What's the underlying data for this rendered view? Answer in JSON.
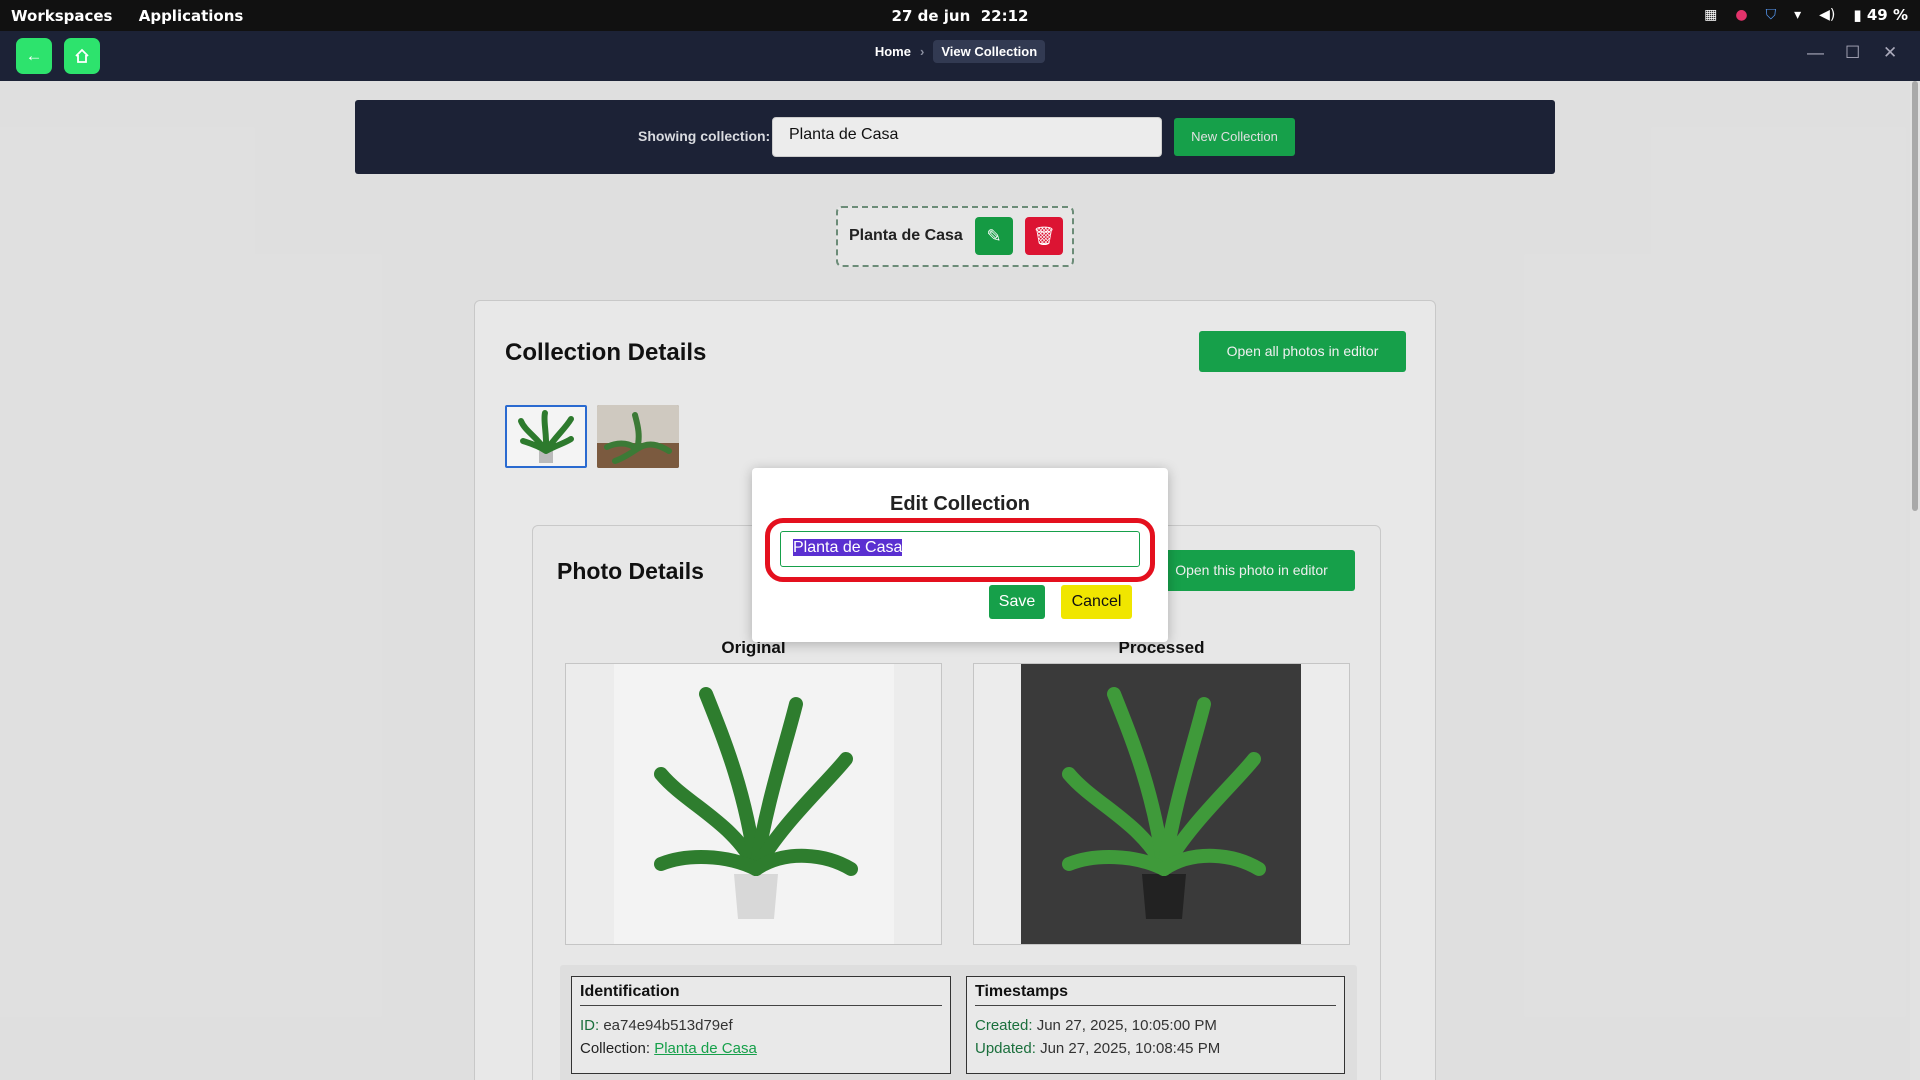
{
  "system_bar": {
    "workspaces": "Workspaces",
    "applications": "Applications",
    "date": "27 de jun",
    "time": "22:12",
    "battery": "49 %"
  },
  "header": {
    "breadcrumb_home": "Home",
    "breadcrumb_separator": "›",
    "breadcrumb_current": "View Collection"
  },
  "collection_bar": {
    "label": "Showing collection:",
    "selected": "Planta de Casa",
    "new_button": "New Collection"
  },
  "chip": {
    "name": "Planta de Casa"
  },
  "collection_details": {
    "title": "Collection Details",
    "open_all_button": "Open all photos in editor"
  },
  "photo_details": {
    "title": "Photo Details",
    "open_this_button": "Open this photo in editor",
    "original_label": "Original",
    "processed_label": "Processed",
    "identification": {
      "title": "Identification",
      "id_key": "ID:",
      "id_value": "ea74e94b513d79ef",
      "collection_key": "Collection:",
      "collection_value": "Planta de Casa"
    },
    "timestamps": {
      "title": "Timestamps",
      "created_key": "Created:",
      "created_value": "Jun 27, 2025, 10:05:00 PM",
      "updated_key": "Updated:",
      "updated_value": "Jun 27, 2025, 10:08:45 PM"
    }
  },
  "modal": {
    "title": "Edit Collection",
    "input_value": "Planta de Casa",
    "save": "Save",
    "cancel": "Cancel"
  },
  "colors": {
    "accent_green": "#16a04a",
    "danger_red": "#dc1433",
    "header_bg": "#1c2236",
    "highlight_red": "#e4101e",
    "cancel_yellow": "#f0e600"
  }
}
